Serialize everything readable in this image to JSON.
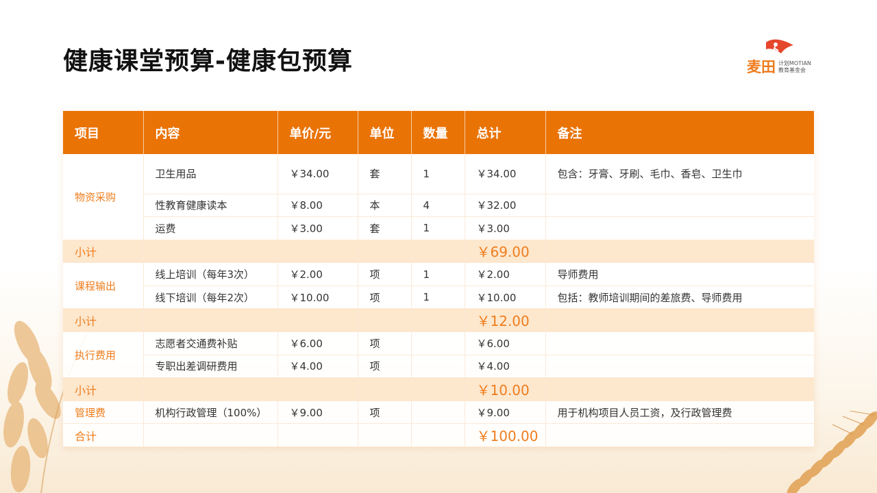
{
  "title": "健康课堂预算-健康包预算",
  "logo": {
    "main": "麦田",
    "line1": "计划MOTIAN",
    "line2": "教育基金会"
  },
  "colors": {
    "accent": "#ea7306",
    "subtotal_bg": "#fde7cd",
    "category_text": "#ef7d1d"
  },
  "table": {
    "headers": [
      "项目",
      "内容",
      "单价/元",
      "单位",
      "数量",
      "总计",
      "备注"
    ],
    "sections": [
      {
        "category": "物资采购",
        "rows": [
          {
            "content": "卫生用品",
            "price": "￥34.00",
            "unit": "套",
            "qty": "1",
            "total": "￥34.00",
            "note": "包含：牙膏、牙刷、毛巾、香皂、卫生巾"
          },
          {
            "content": "性教育健康读本",
            "price": "￥8.00",
            "unit": "本",
            "qty": "4",
            "total": "￥32.00",
            "note": ""
          },
          {
            "content": "运费",
            "price": "￥3.00",
            "unit": "套",
            "qty": "1",
            "total": "￥3.00",
            "note": ""
          }
        ],
        "subtotal_label": "小计",
        "subtotal": "￥69.00"
      },
      {
        "category": "课程输出",
        "rows": [
          {
            "content": "线上培训（每年3次）",
            "price": "￥2.00",
            "unit": "项",
            "qty": "1",
            "total": "￥2.00",
            "note": "导师费用"
          },
          {
            "content": "线下培训（每年2次）",
            "price": "￥10.00",
            "unit": "项",
            "qty": "1",
            "total": "￥10.00",
            "note": "包括：教师培训期间的差旅费、导师费用"
          }
        ],
        "subtotal_label": "小计",
        "subtotal": "￥12.00"
      },
      {
        "category": "执行费用",
        "rows": [
          {
            "content": "志愿者交通费补贴",
            "price": "￥6.00",
            "unit": "项",
            "qty": "",
            "total": "￥6.00",
            "note": ""
          },
          {
            "content": "专职出差调研费用",
            "price": "￥4.00",
            "unit": "项",
            "qty": "",
            "total": "￥4.00",
            "note": ""
          }
        ],
        "subtotal_label": "小计",
        "subtotal": "￥10.00"
      }
    ],
    "management": {
      "category": "管理费",
      "content": "机构行政管理（100%）",
      "price": "￥9.00",
      "unit": "项",
      "qty": "",
      "total": "￥9.00",
      "note": "用于机构项目人员工资，及行政管理费"
    },
    "grand_total_label": "合计",
    "grand_total": "￥100.00"
  }
}
